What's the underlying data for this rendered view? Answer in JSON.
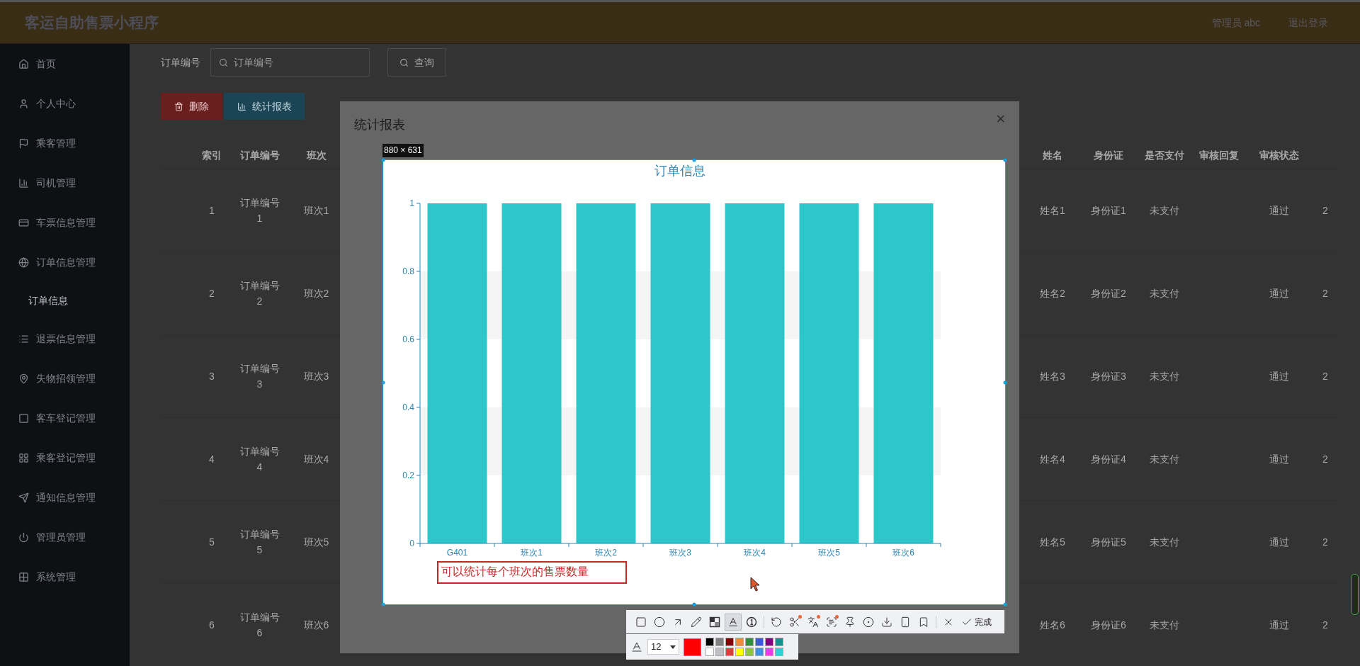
{
  "header": {
    "title": "客运自助售票小程序",
    "user": "管理员 abc",
    "logout": "退出登录"
  },
  "sidebar": {
    "items": [
      {
        "label": "首页",
        "selected": false
      },
      {
        "label": "个人中心",
        "selected": false
      },
      {
        "label": "乘客管理",
        "selected": false
      },
      {
        "label": "司机管理",
        "selected": false
      },
      {
        "label": "车票信息管理",
        "selected": false
      },
      {
        "label": "订单信息管理",
        "selected": false,
        "children": [
          {
            "label": "订单信息",
            "selected": true
          }
        ]
      },
      {
        "label": "退票信息管理",
        "selected": false
      },
      {
        "label": "失物招领管理",
        "selected": false
      },
      {
        "label": "客车登记管理",
        "selected": false
      },
      {
        "label": "乘客登记管理",
        "selected": false
      },
      {
        "label": "通知信息管理",
        "selected": false
      },
      {
        "label": "管理员管理",
        "selected": false
      },
      {
        "label": "系统管理",
        "selected": false
      }
    ]
  },
  "search": {
    "label": "订单编号",
    "placeholder": "订单编号",
    "button": "查询"
  },
  "actions": [
    {
      "label": "删除",
      "kind": "danger"
    },
    {
      "label": "统计报表",
      "kind": "primary"
    }
  ],
  "table": {
    "columns": [
      "索引",
      "订单编号",
      "班次",
      "姓名",
      "身份证",
      "是否支付",
      "审核回复",
      "审核状态"
    ],
    "rows": [
      {
        "index": "1",
        "order_no": "订单编号1",
        "shift": "班次1",
        "name": "姓名1",
        "id_card": "身份证1",
        "paid": "未支付",
        "status": "通过",
        "column_9": "2"
      },
      {
        "index": "2",
        "order_no": "订单编号2",
        "shift": "班次2",
        "name": "姓名2",
        "id_card": "身份证2",
        "paid": "未支付",
        "status": "通过",
        "column_9": "2"
      },
      {
        "index": "3",
        "order_no": "订单编号3",
        "shift": "班次3",
        "name": "姓名3",
        "id_card": "身份证3",
        "paid": "未支付",
        "status": "通过",
        "column_9": "2"
      },
      {
        "index": "4",
        "order_no": "订单编号4",
        "shift": "班次4",
        "name": "姓名4",
        "id_card": "身份证4",
        "paid": "未支付",
        "status": "通过",
        "column_9": "2"
      },
      {
        "index": "5",
        "order_no": "订单编号5",
        "shift": "班次5",
        "name": "姓名5",
        "id_card": "身份证5",
        "paid": "未支付",
        "status": "通过",
        "column_9": "2"
      },
      {
        "index": "6",
        "order_no": "订单编号6",
        "shift": "班次6",
        "name": "姓名6",
        "id_card": "身份证6",
        "paid": "未支付",
        "status": "通过",
        "column_9": "2"
      }
    ]
  },
  "dialog": {
    "title": "统计报表",
    "close": "×",
    "capture": {
      "size": "880 × 631",
      "annotation": "可以统计每个班次的售票数量",
      "chart_data": {
        "type": "bar",
        "title": "订单信息",
        "categories": [
          "G401",
          "班次1",
          "班次2",
          "班次3",
          "班次4",
          "班次5",
          "班次6"
        ],
        "values": [
          1,
          1,
          1,
          1,
          1,
          1,
          1
        ],
        "ylim": [
          0,
          1
        ],
        "yticks": [
          0,
          0.2,
          0.4,
          0.6,
          0.8,
          1
        ]
      }
    }
  },
  "capture_toolbar": {
    "tool_groups": [
      [
        {
          "kind": "rectangle",
          "selected": false,
          "badge": false
        },
        {
          "kind": "ellipse",
          "selected": false,
          "badge": false
        },
        {
          "kind": "arrow",
          "selected": false,
          "badge": false
        },
        {
          "kind": "pencil",
          "selected": false,
          "badge": false
        },
        {
          "kind": "mosaic",
          "selected": false,
          "badge": false
        },
        {
          "kind": "text",
          "selected": true,
          "badge": false
        },
        {
          "kind": "number",
          "selected": false,
          "badge": false
        }
      ],
      [
        {
          "kind": "undo",
          "selected": false,
          "badge": false
        },
        {
          "kind": "cut",
          "selected": false,
          "badge": true
        },
        {
          "kind": "translate",
          "selected": false,
          "badge": true
        },
        {
          "kind": "ocr",
          "selected": false,
          "badge": true
        },
        {
          "kind": "pin",
          "selected": false,
          "badge": false
        },
        {
          "kind": "record",
          "selected": false,
          "badge": false
        },
        {
          "kind": "save",
          "selected": false,
          "badge": false
        },
        {
          "kind": "phone",
          "selected": false,
          "badge": false
        },
        {
          "kind": "bookmark",
          "selected": false,
          "badge": false
        }
      ],
      [
        {
          "kind": "close",
          "selected": false,
          "badge": false
        },
        {
          "kind": "done",
          "label": "完成",
          "selected": false,
          "badge": false
        }
      ]
    ],
    "font_size": "12",
    "current_swatch": {
      "color": "#ff0000"
    },
    "palette": [
      {
        "color": "#000000"
      },
      {
        "color": "#808080"
      },
      {
        "color": "#800000"
      },
      {
        "color": "#f08a3c"
      },
      {
        "color": "#2f8f3f"
      },
      {
        "color": "#3b5bd6"
      },
      {
        "color": "#800080"
      },
      {
        "color": "#168f8f"
      },
      {
        "color": "#ffffff"
      },
      {
        "color": "#c0c0c0"
      },
      {
        "color": "#e03c3c"
      },
      {
        "color": "#ffff00"
      },
      {
        "color": "#8cc63f"
      },
      {
        "color": "#3d8fe0"
      },
      {
        "color": "#e83ce8"
      },
      {
        "color": "#2ed0d8"
      }
    ]
  }
}
